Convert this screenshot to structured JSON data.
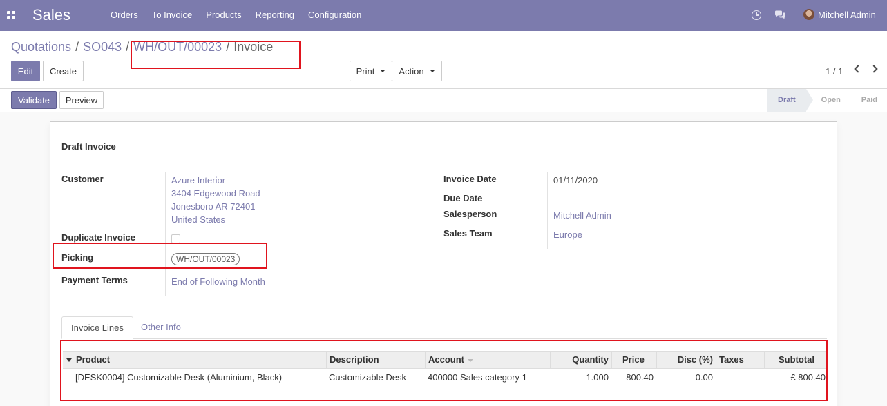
{
  "navbar": {
    "app_title": "Sales",
    "menu": [
      "Orders",
      "To Invoice",
      "Products",
      "Reporting",
      "Configuration"
    ],
    "user_name": "Mitchell Admin",
    "bg_color": "#7c7bad"
  },
  "breadcrumb": {
    "items": [
      "Quotations",
      "SO043",
      "WH/OUT/00023"
    ],
    "current": "Invoice",
    "separator": "/"
  },
  "buttons": {
    "edit": "Edit",
    "create": "Create",
    "print": "Print",
    "action": "Action",
    "validate": "Validate",
    "preview": "Preview"
  },
  "pager": {
    "value": "1 / 1"
  },
  "status": {
    "steps": [
      "Draft",
      "Open",
      "Paid"
    ],
    "active": "Draft"
  },
  "form": {
    "title": "Draft Invoice",
    "customer_label": "Customer",
    "customer_lines": [
      "Azure Interior",
      "3404 Edgewood Road",
      "Jonesboro AR 72401",
      "United States"
    ],
    "duplicate_label": "Duplicate Invoice",
    "duplicate_checked": false,
    "picking_label": "Picking",
    "picking_value": "WH/OUT/00023",
    "payment_terms_label": "Payment Terms",
    "payment_terms_value": "End of Following Month",
    "invoice_date_label": "Invoice Date",
    "invoice_date_value": "01/11/2020",
    "due_date_label": "Due Date",
    "salesperson_label": "Salesperson",
    "salesperson_value": "Mitchell Admin",
    "sales_team_label": "Sales Team",
    "sales_team_value": "Europe"
  },
  "tabs": [
    "Invoice Lines",
    "Other Info"
  ],
  "table": {
    "columns": [
      "Product",
      "Description",
      "Account",
      "Quantity",
      "Price",
      "Disc (%)",
      "Taxes",
      "Subtotal"
    ],
    "rows": [
      {
        "product": "[DESK0004] Customizable Desk (Aluminium, Black)",
        "description": "Customizable Desk",
        "account": "400000 Sales category 1",
        "quantity": "1.000",
        "price": "800.40",
        "discount": "0.00",
        "taxes": "",
        "subtotal": "£ 800.40"
      }
    ]
  },
  "highlight_color": "#e0141e"
}
